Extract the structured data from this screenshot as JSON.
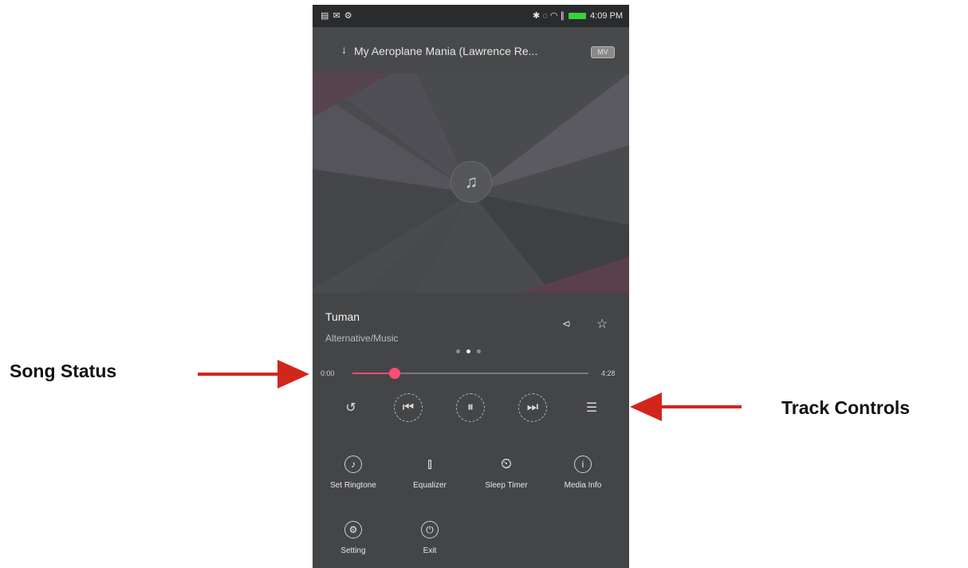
{
  "annotations": {
    "song_status": "Song Status",
    "track_controls": "Track Controls"
  },
  "status_bar": {
    "left_icons": "▤ ✉ ⚙",
    "right_icons": "✱ ◌ ◠ ∥",
    "time": "4:09 PM",
    "battery_color": "#35d23c"
  },
  "header": {
    "back_icon": "download-arrow-icon",
    "title": "My Aeroplane Mania (Lawrence Re...",
    "badge": "MV"
  },
  "album_art": {
    "icon": "music-note-icon",
    "accent": "#5a3f4d"
  },
  "song": {
    "title": "Tuman",
    "artist": "Alternative/Music",
    "share_icon": "share-icon",
    "favorite_icon": "star-icon"
  },
  "page_indicator": {
    "count": 3,
    "active_index": 1
  },
  "progress": {
    "elapsed": "0:00",
    "total": "4:28",
    "fraction": 0.18,
    "accent": "#ff4b73"
  },
  "controls": [
    {
      "icon": "repeat-icon",
      "glyph": "↺"
    },
    {
      "icon": "previous-track-icon",
      "glyph": "⏮"
    },
    {
      "icon": "pause-icon",
      "glyph": "⏸"
    },
    {
      "icon": "next-track-icon",
      "glyph": "⏭"
    },
    {
      "icon": "playlist-icon",
      "glyph": "☰"
    }
  ],
  "menu": [
    {
      "label": "Set Ringtone",
      "icon": "ringtone-icon",
      "glyph": "♪"
    },
    {
      "label": "Equalizer",
      "icon": "equalizer-icon",
      "glyph": "⫾"
    },
    {
      "label": "Sleep Timer",
      "icon": "sleep-timer-icon",
      "glyph": "⏲"
    },
    {
      "label": "Media Info",
      "icon": "info-icon",
      "glyph": "i"
    },
    {
      "label": "Setting",
      "icon": "settings-icon",
      "glyph": "⚙"
    },
    {
      "label": "Exit",
      "icon": "power-icon",
      "glyph": "⏻"
    }
  ]
}
